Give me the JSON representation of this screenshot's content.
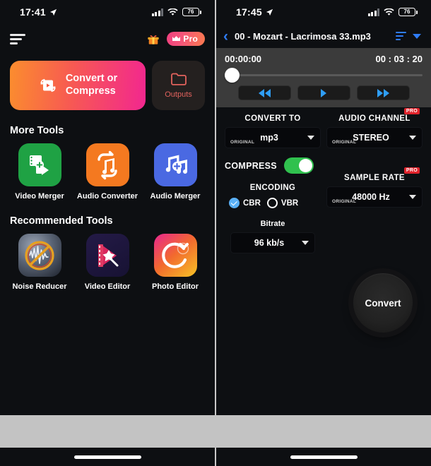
{
  "left": {
    "status": {
      "time": "17:41",
      "battery": "76",
      "location_icon": "location-arrow-icon",
      "wifi_icon": "wifi-icon",
      "signal_icon": "cellular-signal-icon"
    },
    "nav": {
      "menu_icon": "hamburger-menu-icon",
      "gift_icon": "gift-icon",
      "pro_label": "Pro",
      "crown_icon": "crown-icon"
    },
    "hero": {
      "convert_line1": "Convert or",
      "convert_line2": "Compress",
      "convert_icon": "convert-compress-icon",
      "outputs_label": "Outputs",
      "outputs_icon": "folder-icon"
    },
    "more_tools_title": "More Tools",
    "more_tools": [
      {
        "label": "Video Merger",
        "icon": "video-merger-icon",
        "color": "#1fa244"
      },
      {
        "label": "Audio Converter",
        "icon": "audio-converter-icon",
        "color": "#f47920"
      },
      {
        "label": "Audio Merger",
        "icon": "audio-merger-icon",
        "color": "#4a69e2"
      }
    ],
    "recommended_title": "Recommended Tools",
    "recommended_tools": [
      {
        "label": "Noise Reducer",
        "icon": "noise-reducer-icon"
      },
      {
        "label": "Video Editor",
        "icon": "video-editor-icon"
      },
      {
        "label": "Photo Editor",
        "icon": "photo-editor-icon"
      }
    ]
  },
  "right": {
    "status": {
      "time": "17:45",
      "battery": "76",
      "location_icon": "location-arrow-icon",
      "wifi_icon": "wifi-icon",
      "signal_icon": "cellular-signal-icon"
    },
    "titlebar": {
      "back_icon": "chevron-left-icon",
      "filename": "00 - Mozart - Lacrimosa 33.mp3",
      "list_icon": "sort-lines-icon",
      "caret_icon": "chevron-down-icon"
    },
    "player": {
      "current_time": "00:00:00",
      "total_time": "00 : 03 : 20",
      "rewind_icon": "rewind-icon",
      "play_icon": "play-icon",
      "forward_icon": "fast-forward-icon"
    },
    "convert_to": {
      "label": "CONVERT TO",
      "badge": "ORIGINAL",
      "value": "mp3"
    },
    "audio_channel": {
      "label": "AUDIO CHANNEL",
      "pro": "PRO",
      "badge": "ORIGINAL",
      "value": "STEREO"
    },
    "compress": {
      "label": "COMPRESS",
      "state": "on"
    },
    "encoding": {
      "label": "ENCODING",
      "options": [
        {
          "label": "CBR",
          "selected": true
        },
        {
          "label": "VBR",
          "selected": false
        }
      ]
    },
    "sample_rate": {
      "label": "SAMPLE RATE",
      "pro": "PRO",
      "badge": "ORIGINAL",
      "value": "48000 Hz"
    },
    "bitrate": {
      "label": "Bitrate",
      "value": "96 kb/s"
    },
    "convert_button": {
      "label": "Convert"
    }
  },
  "colors": {
    "accent_blue": "#2f7df6",
    "pro_red": "#e0232b",
    "toggle_green": "#30c14e",
    "gradient_start": "#fb8d2e",
    "gradient_end": "#f2278f",
    "outputs_red": "#e2625d"
  }
}
